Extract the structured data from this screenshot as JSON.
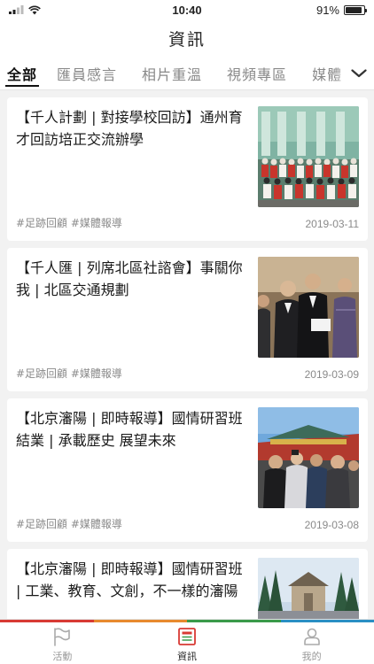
{
  "status_bar": {
    "time": "10:40",
    "battery": "91%",
    "battery_level": 0.91
  },
  "header": {
    "title": "資訊"
  },
  "tabs": [
    {
      "label": "全部",
      "active": true
    },
    {
      "label": "匯員感言",
      "active": false
    },
    {
      "label": "相片重溫",
      "active": false
    },
    {
      "label": "視頻專區",
      "active": false
    },
    {
      "label": "媒體",
      "active": false
    }
  ],
  "articles": [
    {
      "title": "【千人計劃 | 對接學校回訪】通州育才回訪培正交流辦學",
      "tags": "#足跡回顧 #媒體報導",
      "date": "2019-03-11"
    },
    {
      "title": "【千人匯 | 列席北區社諮會】事關你我 | 北區交通規劃",
      "tags": "#足跡回顧 #媒體報導",
      "date": "2019-03-09"
    },
    {
      "title": "【北京瀋陽 | 即時報導】國情研習班結業 | 承載歷史 展望未來",
      "tags": "#足跡回顧 #媒體報導",
      "date": "2019-03-08"
    },
    {
      "title": "【北京瀋陽 | 即時報導】國情研習班 | 工業、教育、文創，不一樣的瀋陽",
      "tags": "",
      "date": ""
    }
  ],
  "bottom_nav": [
    {
      "label": "活動",
      "icon": "flag-icon",
      "active": false
    },
    {
      "label": "資訊",
      "icon": "news-icon",
      "active": true
    },
    {
      "label": "我的",
      "icon": "profile-icon",
      "active": false
    }
  ],
  "colors": {
    "strip": [
      "#d83a34",
      "#e88a2e",
      "#3a9a4a",
      "#2a8fc4"
    ],
    "active_nav_icon": "#d83a34"
  }
}
